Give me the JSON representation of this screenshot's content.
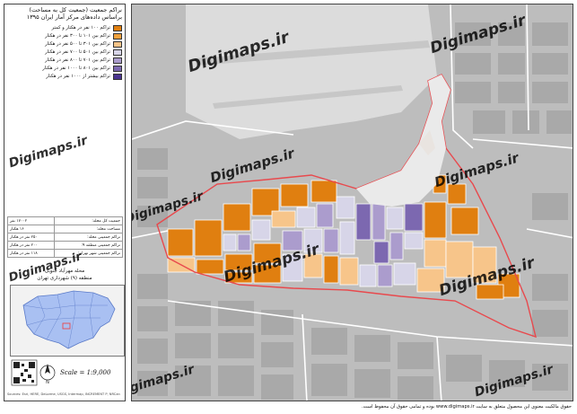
{
  "title": {
    "line1": "نراکم جمعیت (جمعیت کل به مساحت)",
    "line2": "براساس داده‌های مرکز آمار ایران ۱۳۹۵"
  },
  "legend": {
    "items": [
      {
        "label": "تراکم ۱۰۰ نفر در هکتار و کمتر",
        "color": "#e07f10"
      },
      {
        "label": "تراکم بین ۱۰۱ تا ۳۰۰ نفر در هکتار",
        "color": "#f0a23e"
      },
      {
        "label": "تراکم بین ۳۰۱ تا ۵۰۰ نفر در هکتار",
        "color": "#f7c58a"
      },
      {
        "label": "تراکم بین ۵۰۱ تا ۷۰۰ نفر در هکتار",
        "color": "#d7d5e8"
      },
      {
        "label": "تراکم بین ۷۰۱ تا ۸۰۰ نفر در هکتار",
        "color": "#ab9ccd"
      },
      {
        "label": "تراکم بین ۸۰۱ تا ۱۰۰۰ نفر در هکتار",
        "color": "#7c68b0"
      },
      {
        "label": "تراکم بیشتر از ۱۰۰۰ نفر در هکتار",
        "color": "#4b3590"
      }
    ]
  },
  "stats": {
    "rows": [
      {
        "label": "جمعیت کل محله:",
        "value": "۱۷۰۰۲ نفر"
      },
      {
        "label": "مساحت محله:",
        "value": "۱۶ هکتار"
      },
      {
        "label": "تراکم جمعیتی محله:",
        "value": "۲۵۰ نفر در هکتار"
      },
      {
        "label": "تراکم جمعیتی منطقه ۹:",
        "value": "۲۰۰ نفر در هکتار"
      },
      {
        "label": "تراکم جمعیتی شهر تهران:",
        "value": "۱۱۸ نفر در هکتار"
      }
    ]
  },
  "district": {
    "line1": "محله مهرآباد جنوبی",
    "line2": "منطقه (۹) شهرداری تهران"
  },
  "scale": {
    "text": "Scale = 1:9,000",
    "north_symbol": "N"
  },
  "credit": "Sources: Esri, HERE, DeLorme, USGS, Intermap, INCREMENT P, NRCan",
  "watermark": "Digimaps.ir",
  "footer": "حقوق مالکیت معنوی این محصول متعلق به سایت www.digimaps.ir بوده و تمامی حقوق آن محفوظ است.",
  "colors": {
    "boundary": "#e8494d",
    "basemap": "#bcbcbc",
    "airport": "#dedede",
    "inset_highlight": "#7a9ee8"
  }
}
